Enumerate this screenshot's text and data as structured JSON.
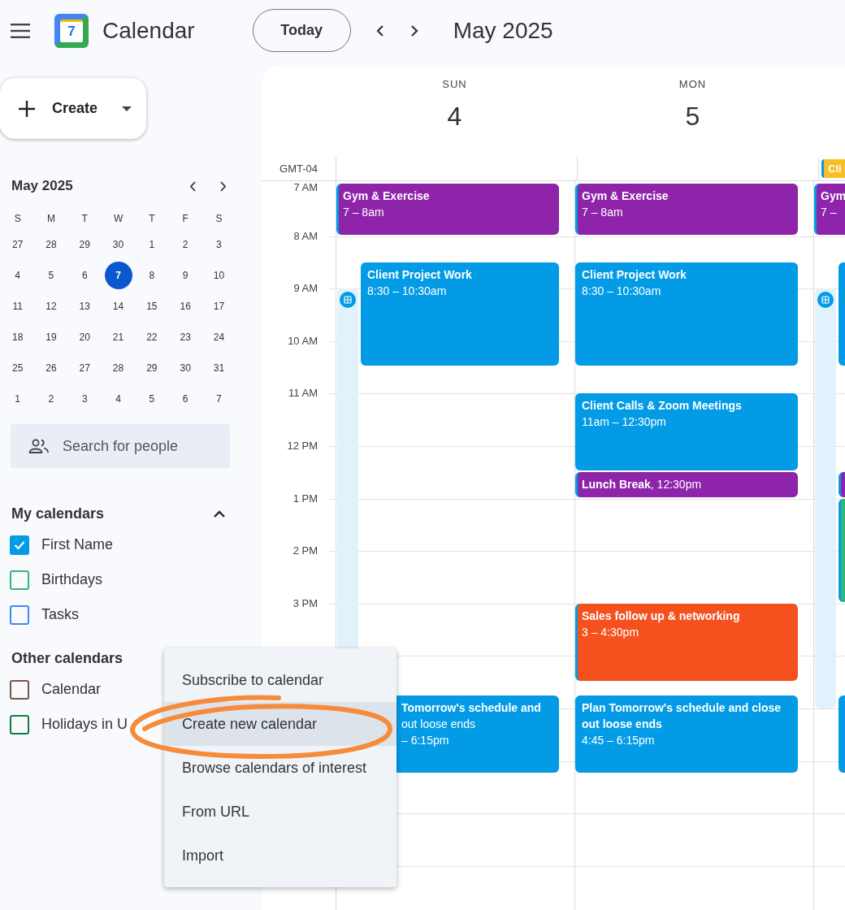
{
  "app": {
    "title": "Calendar",
    "logo_day": "7"
  },
  "toolbar": {
    "today_button": "Today",
    "period": "May 2025"
  },
  "create_button": "Create",
  "mini_calendar": {
    "month": "May 2025",
    "weekdays": [
      "S",
      "M",
      "T",
      "W",
      "T",
      "F",
      "S"
    ],
    "weeks": [
      [
        {
          "day": "27",
          "selected": false
        },
        {
          "day": "28",
          "selected": false
        },
        {
          "day": "29",
          "selected": false
        },
        {
          "day": "30",
          "selected": false
        },
        {
          "day": "1",
          "selected": false
        },
        {
          "day": "2",
          "selected": false
        },
        {
          "day": "3",
          "selected": false
        }
      ],
      [
        {
          "day": "4",
          "selected": false
        },
        {
          "day": "5",
          "selected": false
        },
        {
          "day": "6",
          "selected": false
        },
        {
          "day": "7",
          "selected": true
        },
        {
          "day": "8",
          "selected": false
        },
        {
          "day": "9",
          "selected": false
        },
        {
          "day": "10",
          "selected": false
        }
      ],
      [
        {
          "day": "11",
          "selected": false
        },
        {
          "day": "12",
          "selected": false
        },
        {
          "day": "13",
          "selected": false
        },
        {
          "day": "14",
          "selected": false
        },
        {
          "day": "15",
          "selected": false
        },
        {
          "day": "16",
          "selected": false
        },
        {
          "day": "17",
          "selected": false
        }
      ],
      [
        {
          "day": "18",
          "selected": false
        },
        {
          "day": "19",
          "selected": false
        },
        {
          "day": "20",
          "selected": false
        },
        {
          "day": "21",
          "selected": false
        },
        {
          "day": "22",
          "selected": false
        },
        {
          "day": "23",
          "selected": false
        },
        {
          "day": "24",
          "selected": false
        }
      ],
      [
        {
          "day": "25",
          "selected": false
        },
        {
          "day": "26",
          "selected": false
        },
        {
          "day": "27",
          "selected": false
        },
        {
          "day": "28",
          "selected": false
        },
        {
          "day": "29",
          "selected": false
        },
        {
          "day": "30",
          "selected": false
        },
        {
          "day": "31",
          "selected": false
        }
      ],
      [
        {
          "day": "1",
          "selected": false
        },
        {
          "day": "2",
          "selected": false
        },
        {
          "day": "3",
          "selected": false
        },
        {
          "day": "4",
          "selected": false
        },
        {
          "day": "5",
          "selected": false
        },
        {
          "day": "6",
          "selected": false
        },
        {
          "day": "7",
          "selected": false
        }
      ]
    ]
  },
  "search": {
    "placeholder": "Search for people"
  },
  "my_calendars": {
    "title": "My calendars",
    "expanded": true,
    "items": [
      {
        "label": "First Name",
        "checked": true,
        "color": "#039be5"
      },
      {
        "label": "Birthdays",
        "checked": false,
        "color": "#33b679"
      },
      {
        "label": "Tasks",
        "checked": false,
        "color": "#4285f4"
      }
    ]
  },
  "other_calendars": {
    "title": "Other calendars",
    "items": [
      {
        "label": "Calendar",
        "checked": false,
        "color": "#795548"
      },
      {
        "label": "Holidays in U",
        "checked": false,
        "color": "#0b8043"
      }
    ]
  },
  "grid": {
    "timezone": "GMT-04",
    "time_labels": [
      "7 AM",
      "8 AM",
      "9 AM",
      "10 AM",
      "11 AM",
      "12 PM",
      "1 PM",
      "2 PM",
      "3 PM"
    ],
    "days": [
      {
        "weekday": "SUN",
        "date": "4",
        "events": [
          {
            "kind": "block",
            "color": "#039be5"
          },
          {
            "kind": "event",
            "title": "Gym & Exercise",
            "time": "7 – 8am",
            "color": "#8e24aa"
          },
          {
            "kind": "event",
            "title": "Client Project Work",
            "time": "8:30 – 10:30am",
            "color": "#039be5"
          },
          {
            "kind": "event",
            "title": "Tomorrow's schedule and",
            "time": "out loose ends\n– 6:15pm",
            "color": "#039be5"
          }
        ]
      },
      {
        "weekday": "MON",
        "date": "5",
        "events": [
          {
            "kind": "event",
            "title": "Gym & Exercise",
            "time": "7 – 8am",
            "color": "#8e24aa"
          },
          {
            "kind": "event",
            "title": "Client Project Work",
            "time": "8:30 – 10:30am",
            "color": "#039be5"
          },
          {
            "kind": "event",
            "title": "Client Calls & Zoom Meetings",
            "time": "11am – 12:30pm",
            "color": "#039be5"
          },
          {
            "kind": "compact",
            "text": "**Lunch Break**, 12:30pm",
            "color": "#8e24aa"
          },
          {
            "kind": "event",
            "title": "Sales follow up & networking",
            "time": "3 – 4:30pm",
            "color": "#f4511e"
          },
          {
            "kind": "event",
            "title": "Plan Tomorrow's schedule and close out loose ends",
            "time": "4:45 – 6:15pm",
            "color": "#039be5"
          }
        ]
      },
      {
        "all_day": [
          {
            "title": "Cli",
            "color": "#f6bf26"
          }
        ],
        "events": [
          {
            "kind": "block",
            "color": "#039be5"
          },
          {
            "kind": "event",
            "title": "Gym",
            "time": "7 –",
            "color": "#8e24aa"
          },
          {
            "kind": "event",
            "color": "#039be5"
          },
          {
            "kind": "event",
            "color": "#8e24aa"
          },
          {
            "kind": "event",
            "color": "#33b679"
          },
          {
            "kind": "event",
            "color": "#039be5"
          }
        ]
      }
    ]
  },
  "menu": [
    {
      "label": "Subscribe to calendar",
      "selected": false
    },
    {
      "label": "Create new calendar",
      "selected": true
    },
    {
      "label": "Browse calendars of interest",
      "selected": false
    },
    {
      "label": "From URL",
      "selected": false
    },
    {
      "label": "Import",
      "selected": false
    }
  ]
}
